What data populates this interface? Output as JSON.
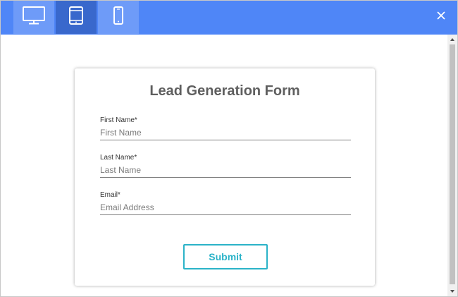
{
  "toolbar": {
    "devices": [
      {
        "icon": "desktop-icon",
        "active": false
      },
      {
        "icon": "tablet-icon",
        "active": true
      },
      {
        "icon": "mobile-icon",
        "active": false
      }
    ],
    "close_icon": "close-icon",
    "accent_color": "#4f86f7"
  },
  "form": {
    "title": "Lead Generation Form",
    "fields": [
      {
        "label": "First Name*",
        "placeholder": "First Name",
        "value": ""
      },
      {
        "label": "Last Name*",
        "placeholder": "Last Name",
        "value": ""
      },
      {
        "label": "Email*",
        "placeholder": "Email Address",
        "value": ""
      }
    ],
    "submit_label": "Submit",
    "button_color": "#2bb3c8"
  }
}
